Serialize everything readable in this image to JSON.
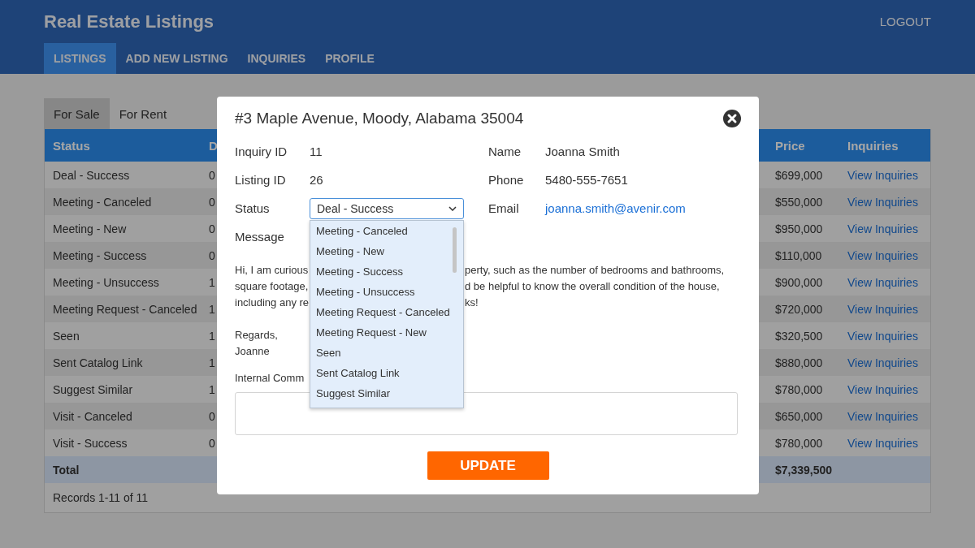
{
  "header": {
    "title": "Real Estate Listings",
    "logout": "LOGOUT",
    "nav": [
      {
        "label": "LISTINGS",
        "selected": true
      },
      {
        "label": "ADD NEW LISTING",
        "selected": false
      },
      {
        "label": "INQUIRIES",
        "selected": false
      },
      {
        "label": "PROFILE",
        "selected": false
      }
    ]
  },
  "tabs": [
    {
      "label": "For Sale",
      "selected": true
    },
    {
      "label": "For Rent",
      "selected": false
    }
  ],
  "table": {
    "columns": [
      "Status",
      "D",
      "Price",
      "Inquiries"
    ],
    "rows": [
      {
        "status": "Deal - Success",
        "column_2": "0",
        "price": "$699,000",
        "link": "View Inquiries"
      },
      {
        "status": "Meeting - Canceled",
        "column_2": "0",
        "price": "$550,000",
        "link": "View Inquiries"
      },
      {
        "status": "Meeting - New",
        "column_2": "0",
        "price": "$950,000",
        "link": "View Inquiries"
      },
      {
        "status": "Meeting - Success",
        "column_2": "0",
        "price": "$110,000",
        "link": "View Inquiries"
      },
      {
        "status": "Meeting - Unsuccess",
        "column_2": "1",
        "price": "$900,000",
        "link": "View Inquiries"
      },
      {
        "status": "Meeting Request - Canceled",
        "column_2": "1",
        "price": "$720,000",
        "link": "View Inquiries"
      },
      {
        "status": "Seen",
        "column_2": "1",
        "price": "$320,500",
        "link": "View Inquiries"
      },
      {
        "status": "Sent Catalog Link",
        "column_2": "1",
        "price": "$880,000",
        "link": "View Inquiries"
      },
      {
        "status": "Suggest Similar",
        "column_2": "1",
        "price": "$780,000",
        "link": "View Inquiries"
      },
      {
        "status": "Visit - Canceled",
        "column_2": "0",
        "price": "$650,000",
        "link": "View Inquiries"
      },
      {
        "status": "Visit - Success",
        "column_2": "0",
        "price": "$780,000",
        "link": "View Inquiries"
      }
    ],
    "total": {
      "label": "Total",
      "price": "$7,339,500"
    },
    "records": "Records 1-11 of 11"
  },
  "modal": {
    "title": "#3 Maple Avenue, Moody, Alabama 35004",
    "fields_left": [
      {
        "label": "Inquiry ID",
        "value": "11"
      },
      {
        "label": "Listing ID",
        "value": "26"
      }
    ],
    "status": {
      "label": "Status",
      "value": "Deal - Success",
      "options": [
        {
          "label": "Meeting - Canceled",
          "selected": false
        },
        {
          "label": "Meeting - New",
          "selected": false
        },
        {
          "label": "Meeting - Success",
          "selected": false
        },
        {
          "label": "Meeting - Unsuccess",
          "selected": false
        },
        {
          "label": "Meeting Request - Canceled",
          "selected": false
        },
        {
          "label": "Meeting Request - New",
          "selected": false
        },
        {
          "label": "Seen",
          "selected": false
        },
        {
          "label": "Sent Catalog Link",
          "selected": false
        },
        {
          "label": "Suggest Similar",
          "selected": false
        }
      ]
    },
    "fields_right": [
      {
        "label": "Name",
        "value": "Joanna Smith",
        "kind": "text"
      },
      {
        "label": "Phone",
        "value": "5480-555-7651",
        "kind": "text"
      },
      {
        "label": "Email",
        "value": "joanna.smith@avenir.com",
        "kind": "link"
      }
    ],
    "message_label": "Message",
    "message_lines": [
      {
        "left": "Hi, I am curious",
        "right": "perty, such as the number of bedrooms and bathrooms,"
      },
      {
        "left": "square footage,",
        "right": "d be helpful to know the overall condition of the house,"
      },
      {
        "left": "including any re",
        "right": "ks!"
      }
    ],
    "signature": [
      "Regards,",
      "Joanne"
    ],
    "comment_label": "Internal Comm",
    "button": "UPDATE"
  }
}
